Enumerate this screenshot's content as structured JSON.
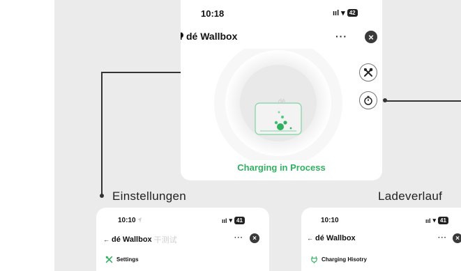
{
  "main_phone": {
    "time": "10:18",
    "signal": "ııl",
    "wifi": "▾",
    "battery": "42",
    "app_title": "dé Wallbox",
    "logo_icon": "bulb-icon",
    "menu_label": "···",
    "close_label": "×",
    "status_text": "Charging in Process",
    "illustration_brand": "dé"
  },
  "callouts": {
    "settings_label": "Einstellungen",
    "history_label": "Ladeverlauf"
  },
  "settings_phone": {
    "time": "10:10",
    "signal": "ııl",
    "wifi": "▾",
    "battery": "41",
    "back_label": "←",
    "app_title": "dé Wallbox",
    "ghost_text": "干测试",
    "menu_label": "···",
    "close_label": "×",
    "section_title": "Settings"
  },
  "history_phone": {
    "time": "10:10",
    "signal": "ııl",
    "wifi": "▾",
    "battery": "41",
    "back_label": "←",
    "app_title": "dé Wallbox",
    "menu_label": "···",
    "close_label": "×",
    "section_title": "Charging Hisotry"
  },
  "colors": {
    "accent_green": "#2fb15f",
    "panel_gray": "#ebebeb",
    "close_dark": "#3a3a3a"
  }
}
